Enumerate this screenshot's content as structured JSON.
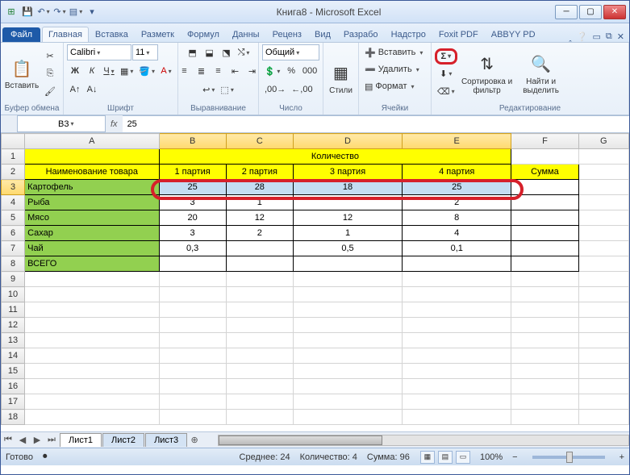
{
  "title": "Книга8 - Microsoft Excel",
  "qat": {
    "save": "💾",
    "undo": "↶",
    "redo": "↷"
  },
  "tabs": {
    "file": "Файл",
    "items": [
      "Главная",
      "Вставка",
      "Разметк",
      "Формул",
      "Данны",
      "Реценз",
      "Вид",
      "Разрабо",
      "Надстро",
      "Foxit PDF",
      "ABBYY PD"
    ],
    "active": 0
  },
  "ribbon": {
    "clipboard": {
      "paste": "Вставить",
      "label": "Буфер обмена"
    },
    "font": {
      "name": "Calibri",
      "size": "11",
      "bold": "Ж",
      "italic": "К",
      "underline": "Ч",
      "label": "Шрифт"
    },
    "align": {
      "label": "Выравнивание"
    },
    "number": {
      "format": "Общий",
      "label": "Число"
    },
    "styles": {
      "btn": "Стили",
      "label": ""
    },
    "cells": {
      "insert": "Вставить",
      "delete": "Удалить",
      "format": "Формат",
      "label": "Ячейки"
    },
    "editing": {
      "autosum": "Σ",
      "sort": "Сортировка и фильтр",
      "find": "Найти и выделить",
      "label": "Редактирование"
    }
  },
  "formula": {
    "namebox": "B3",
    "value": "25"
  },
  "columns": [
    "A",
    "B",
    "C",
    "D",
    "E",
    "F",
    "G"
  ],
  "data": {
    "header_merged": "Количество",
    "col_headers": [
      "Наименование товара",
      "1 партия",
      "2 партия",
      "3 партия",
      "4 партия",
      "Сумма"
    ],
    "rows": [
      {
        "name": "Картофель",
        "vals": [
          "25",
          "28",
          "18",
          "25"
        ]
      },
      {
        "name": "Рыба",
        "vals": [
          "3",
          "1",
          "",
          "2"
        ]
      },
      {
        "name": "Мясо",
        "vals": [
          "20",
          "12",
          "12",
          "8"
        ]
      },
      {
        "name": "Сахар",
        "vals": [
          "3",
          "2",
          "1",
          "4"
        ]
      },
      {
        "name": "Чай",
        "vals": [
          "0,3",
          "",
          "0,5",
          "0,1"
        ]
      },
      {
        "name": "ВСЕГО",
        "vals": [
          "",
          "",
          "",
          ""
        ]
      }
    ]
  },
  "sheets": [
    "Лист1",
    "Лист2",
    "Лист3"
  ],
  "status": {
    "ready": "Готово",
    "avg_label": "Среднее:",
    "avg": "24",
    "count_label": "Количество:",
    "count": "4",
    "sum_label": "Сумма:",
    "sum": "96",
    "zoom": "100%"
  },
  "chart_data": {
    "type": "table",
    "title": "Количество",
    "columns": [
      "Наименование товара",
      "1 партия",
      "2 партия",
      "3 партия",
      "4 партия",
      "Сумма"
    ],
    "rows": [
      [
        "Картофель",
        25,
        28,
        18,
        25,
        null
      ],
      [
        "Рыба",
        3,
        1,
        null,
        2,
        null
      ],
      [
        "Мясо",
        20,
        12,
        12,
        8,
        null
      ],
      [
        "Сахар",
        3,
        2,
        1,
        4,
        null
      ],
      [
        "Чай",
        0.3,
        null,
        0.5,
        0.1,
        null
      ],
      [
        "ВСЕГО",
        null,
        null,
        null,
        null,
        null
      ]
    ]
  }
}
